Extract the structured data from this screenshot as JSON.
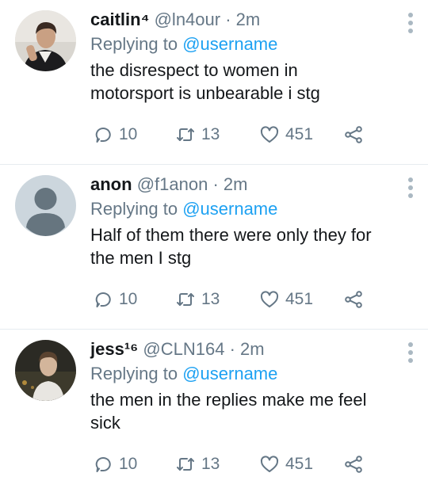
{
  "tweets": [
    {
      "name": "caitlin⁴",
      "handle": "@ln4our",
      "sep": "·",
      "time": "2m",
      "reply_prefix": "Replying to",
      "reply_to": "@username",
      "line1": "the disrespect to women in",
      "line2": "motorsport is unbearable i stg",
      "replies": "10",
      "retweets": "13",
      "likes": "451"
    },
    {
      "name": "anon",
      "handle": "@f1anon",
      "sep": "·",
      "time": "2m",
      "reply_prefix": "Replying to",
      "reply_to": "@username",
      "line1": "Half of them there were only they for",
      "line2": "the men I stg",
      "replies": "10",
      "retweets": "13",
      "likes": "451"
    },
    {
      "name": "jess¹⁶",
      "handle": "@CLN164",
      "sep": "·",
      "time": "2m",
      "reply_prefix": "Replying to",
      "reply_to": "@username",
      "line1": "the men in the replies make me feel",
      "line2": "sick",
      "replies": "10",
      "retweets": "13",
      "likes": "451"
    }
  ],
  "icons": {
    "reply": "reply-icon",
    "retweet": "retweet-icon",
    "like": "heart-icon",
    "share": "share-icon",
    "more": "more-vertical-icon"
  },
  "colors": {
    "accent": "#1da1f2",
    "secondary_text": "#657786",
    "divider": "#e6ecf0"
  }
}
